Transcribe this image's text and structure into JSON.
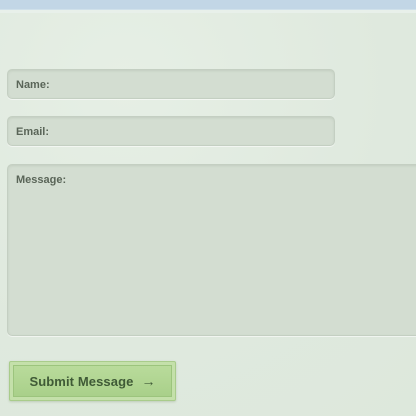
{
  "form": {
    "name_label": "Name:",
    "email_label": "Email:",
    "message_label": "Message:",
    "submit_label": "Submit Message",
    "submit_arrow": "→"
  },
  "colors": {
    "background": "#e2ece2",
    "top_bar": "#c2d6e6",
    "field_fill": "#d3ddd1",
    "button_fill": "#b4d894",
    "button_text": "#3f5a36"
  }
}
